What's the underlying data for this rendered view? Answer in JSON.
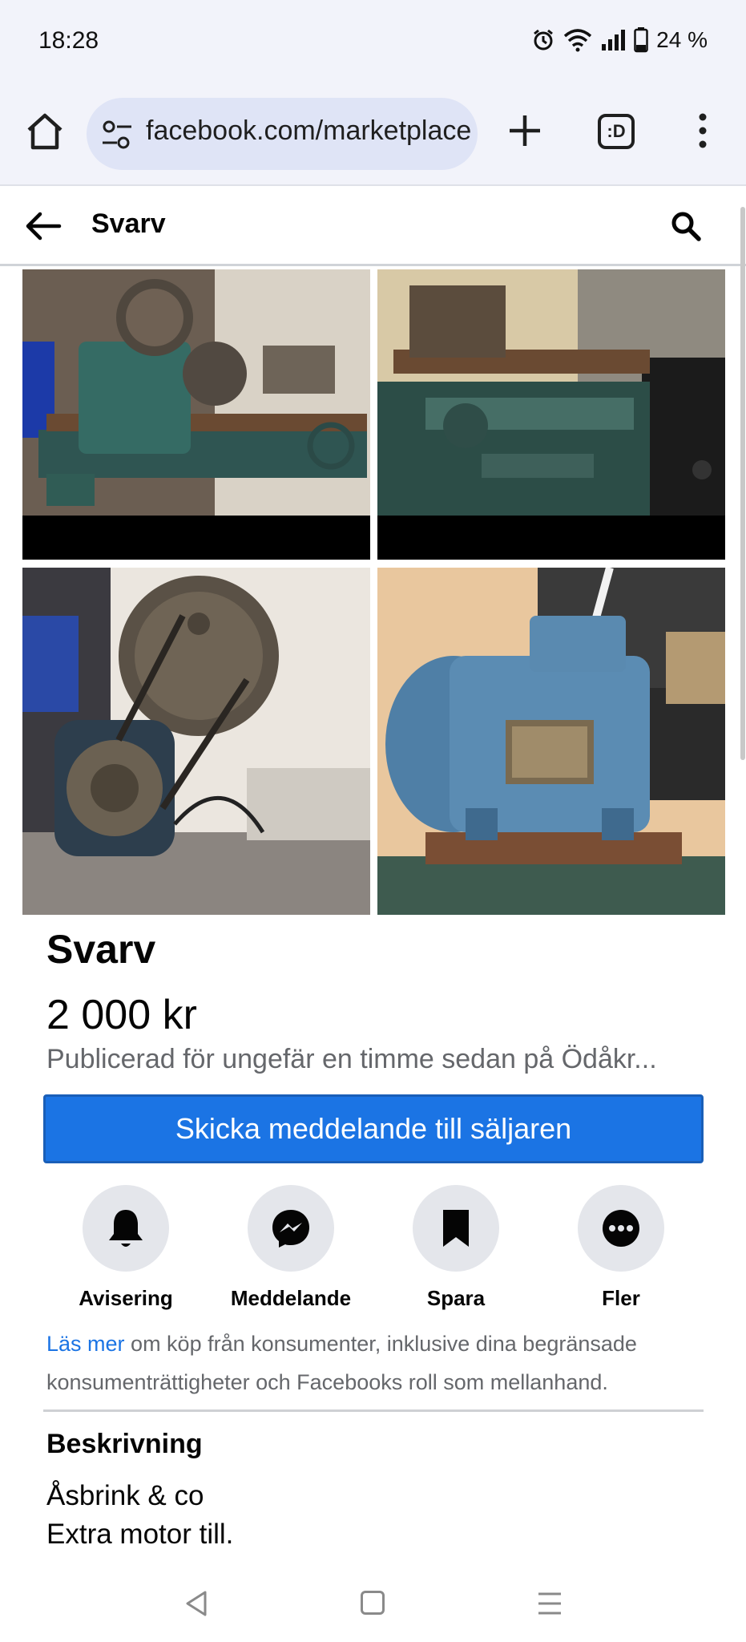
{
  "status": {
    "time": "18:28",
    "battery": "24 %",
    "icons": [
      "alarm-icon",
      "wifi-icon",
      "signal-icon",
      "battery-icon"
    ]
  },
  "browser": {
    "url": "facebook.com/marketplace",
    "tabs_icon_label": ":D",
    "icons": [
      "home-icon",
      "site-settings-icon",
      "new-tab-icon",
      "tabs-icon",
      "more-vert-icon"
    ]
  },
  "header": {
    "title": "Svarv"
  },
  "listing": {
    "title": "Svarv",
    "price": "2 000 kr",
    "posted": "Publicerad för ungefär en timme sedan på Ödåkr...",
    "message_button": "Skicka meddelande till säljaren"
  },
  "actions": [
    {
      "label": "Avisering",
      "icon": "bell-icon"
    },
    {
      "label": "Meddelande",
      "icon": "messenger-icon"
    },
    {
      "label": "Spara",
      "icon": "bookmark-icon"
    },
    {
      "label": "Fler",
      "icon": "more-horizontal-icon"
    }
  ],
  "notice": {
    "link": "Läs mer",
    "text": " om köp från konsumenter, inklusive dina begränsade konsumenträttigheter och Facebooks roll som mellanhand."
  },
  "description": {
    "heading": "Beskrivning",
    "line1": "Åsbrink & co",
    "line2": "Extra motor till."
  },
  "colors": {
    "accent": "#1b74e4",
    "secondary_text": "#65676b",
    "browser_chrome": "#f2f3fa"
  }
}
